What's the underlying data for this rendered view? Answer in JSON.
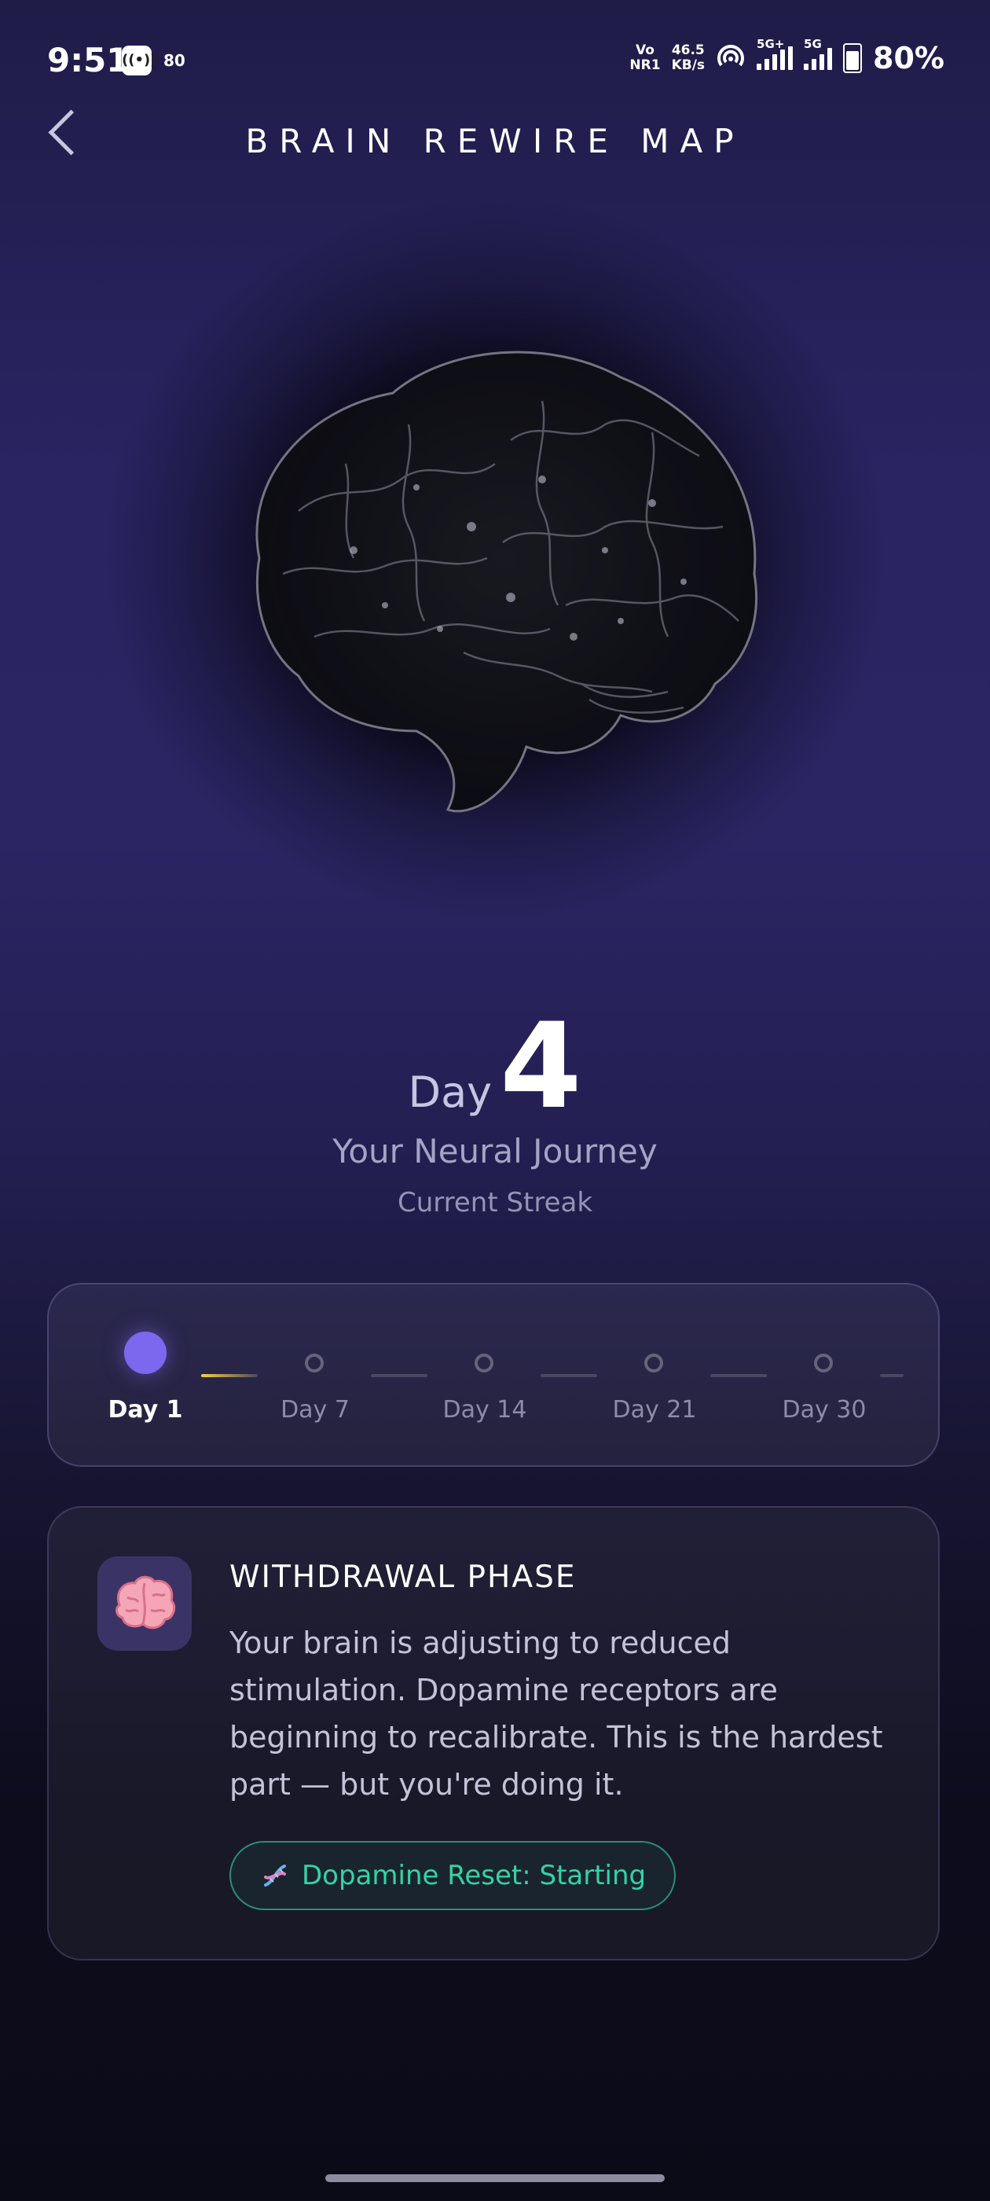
{
  "status_bar": {
    "time": "9:51",
    "badge": "80",
    "network_top": "Vo",
    "network_bottom": "NR1",
    "speed_top": "46.5",
    "speed_bottom": "KB/s",
    "sig1": "5G+",
    "sig2": "5G",
    "battery": "80%"
  },
  "header": {
    "title": "BRAIN REWIRE MAP"
  },
  "streak": {
    "day_word": "Day",
    "day_number": "4",
    "subtitle": "Your Neural Journey",
    "caption": "Current Streak"
  },
  "timeline": {
    "milestones": [
      {
        "label": "Day 1",
        "active": true
      },
      {
        "label": "Day 7",
        "active": false
      },
      {
        "label": "Day 14",
        "active": false
      },
      {
        "label": "Day 21",
        "active": false
      },
      {
        "label": "Day 30",
        "active": false
      }
    ]
  },
  "phase": {
    "icon": "brain-emoji-icon",
    "title": "WITHDRAWAL PHASE",
    "description": "Your brain is adjusting to reduced stimulation. Dopamine receptors are beginning to recalibrate. This is the hardest part — but you're doing it.",
    "badge_icon": "dna-icon",
    "badge_text": "Dopamine Reset: Starting"
  },
  "colors": {
    "accent": "#7b68ee",
    "progress": "#f2d23c",
    "badge": "#34d3a4"
  }
}
